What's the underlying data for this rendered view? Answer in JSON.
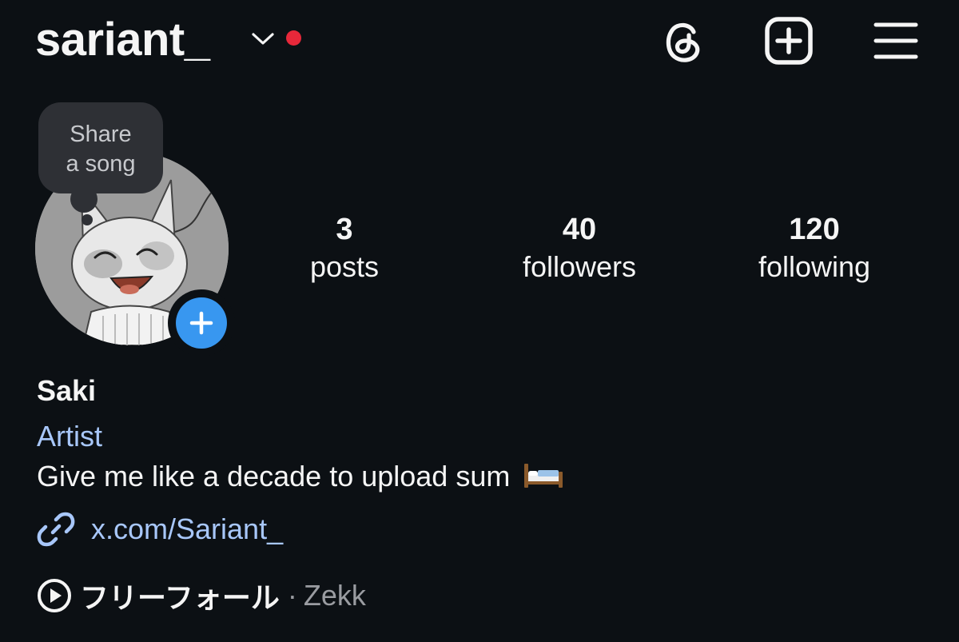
{
  "header": {
    "username": "sariant_",
    "notification_dot_color": "#e7283a",
    "icons": [
      "chevron-down-icon",
      "threads-icon",
      "new-post-icon",
      "menu-icon"
    ]
  },
  "note_bubble": {
    "line1": "Share",
    "line2": "a song"
  },
  "avatar": {
    "add_story_color": "#3897f0"
  },
  "stats": {
    "posts": {
      "count": "3",
      "label": "posts"
    },
    "followers": {
      "count": "40",
      "label": "followers"
    },
    "following": {
      "count": "120",
      "label": "following"
    }
  },
  "bio": {
    "name": "Saki",
    "category": "Artist",
    "category_color": "#a8c7fa",
    "text": "Give me like a decade to upload sum",
    "emoji": "bed-icon",
    "link": "x.com/Sariant_",
    "link_color": "#a8c7fa"
  },
  "music": {
    "song": "フリーフォール",
    "separator": "·",
    "artist": "Zekk"
  }
}
